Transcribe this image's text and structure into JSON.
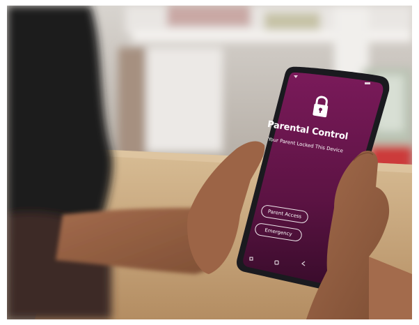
{
  "screen": {
    "title": "Parental Control",
    "subtitle": "Your Parent Locked This Device",
    "parent_access_label": "Parent Access",
    "emergency_label": "Emergency"
  },
  "icons": {
    "lock": "lock-icon",
    "nav_back": "back-icon",
    "nav_home": "home-icon",
    "nav_recents": "recents-icon"
  },
  "colors": {
    "screen_top": "#7a1a5a",
    "screen_bottom": "#3a0c2c",
    "phone_body": "#1a1a1f",
    "table": "#c9a87c"
  }
}
